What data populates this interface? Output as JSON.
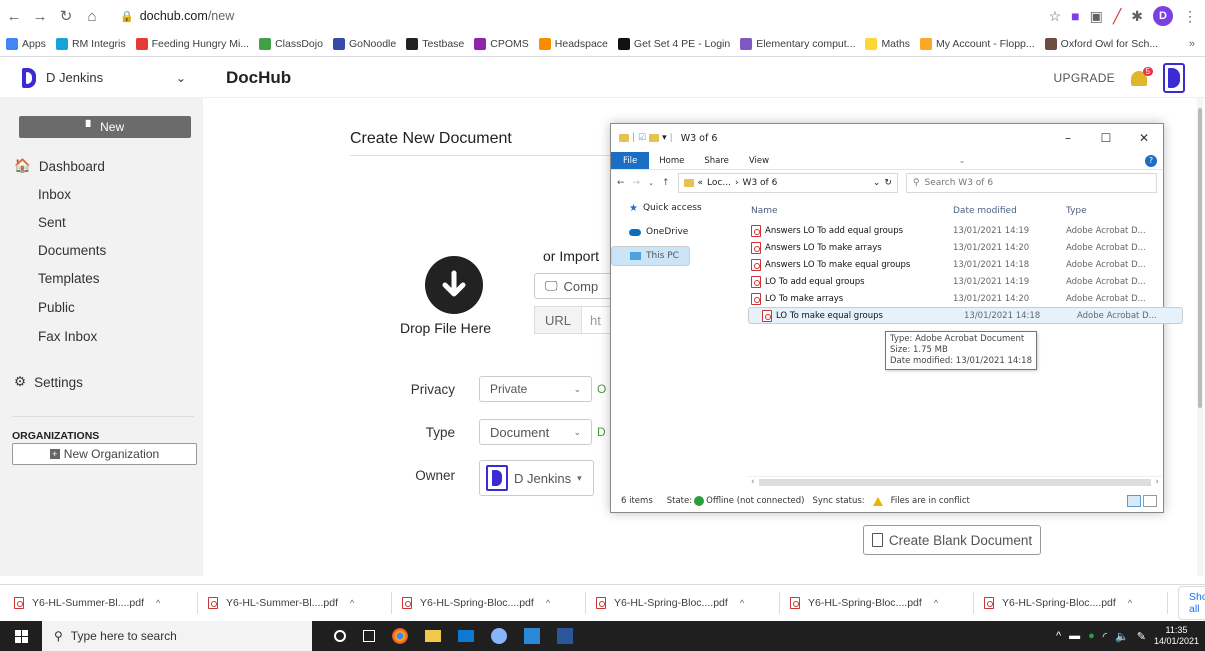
{
  "browser": {
    "url_host": "dochub.com",
    "url_path": "/new",
    "profile_initial": "D",
    "bookmarks": [
      {
        "label": "Apps",
        "color": "#4285f4"
      },
      {
        "label": "RM Integris",
        "color": "#1aa3d9"
      },
      {
        "label": "Feeding Hungry Mi...",
        "color": "#e53935"
      },
      {
        "label": "ClassDojo",
        "color": "#43a047"
      },
      {
        "label": "GoNoodle",
        "color": "#3949ab"
      },
      {
        "label": "Testbase",
        "color": "#222222"
      },
      {
        "label": "CPOMS",
        "color": "#8e24aa"
      },
      {
        "label": "Headspace",
        "color": "#fb8c00"
      },
      {
        "label": "Get Set 4 PE - Login",
        "color": "#111111"
      },
      {
        "label": "Elementary comput...",
        "color": "#7e57c2"
      },
      {
        "label": "Maths",
        "color": "#fdd835"
      },
      {
        "label": "My Account - Flopp...",
        "color": "#f9a825"
      },
      {
        "label": "Oxford Owl for Sch...",
        "color": "#6d4c41"
      }
    ],
    "bookmarks_more": "»"
  },
  "header": {
    "user_name": "D Jenkins",
    "brand": "DocHub",
    "upgrade": "UPGRADE",
    "notif_count": "5"
  },
  "sidebar": {
    "new_button": "New",
    "dashboard": "Dashboard",
    "items": [
      "Inbox",
      "Sent",
      "Documents",
      "Templates",
      "Public",
      "Fax Inbox"
    ],
    "settings": "Settings",
    "organizations_heading": "ORGANIZATIONS",
    "new_org_button": "New Organization"
  },
  "main": {
    "title": "Create New Document",
    "drop_label": "Drop File Here",
    "import_label": "or Import",
    "computer_label": "Comp",
    "url_label": "URL",
    "url_value": "ht",
    "privacy_label": "Privacy",
    "privacy_value": "Private",
    "privacy_note": "O",
    "type_label": "Type",
    "type_value": "Document",
    "type_note": "D",
    "owner_label": "Owner",
    "owner_value": "D Jenkins",
    "blank_button": "Create Blank Document"
  },
  "explorer": {
    "title": "W3 of 6",
    "ribbon": {
      "file": "File",
      "home": "Home",
      "share": "Share",
      "view": "View",
      "help": "?"
    },
    "path": [
      "Loc...",
      "W3 of 6"
    ],
    "search_placeholder": "Search W3 of 6",
    "nav": [
      {
        "label": "Quick access",
        "icon": "star-icon"
      },
      {
        "label": "OneDrive",
        "icon": "cloud-icon"
      },
      {
        "label": "This PC",
        "icon": "pc-icon"
      }
    ],
    "columns": {
      "name": "Name",
      "date": "Date modified",
      "type": "Type"
    },
    "files": [
      {
        "name": "Answers LO To add equal groups",
        "date": "13/01/2021 14:19",
        "type": "Adobe Acrobat D..."
      },
      {
        "name": "Answers LO To make arrays",
        "date": "13/01/2021 14:20",
        "type": "Adobe Acrobat D..."
      },
      {
        "name": "Answers LO To make equal groups",
        "date": "13/01/2021 14:18",
        "type": "Adobe Acrobat D..."
      },
      {
        "name": "LO To add equal groups",
        "date": "13/01/2021 14:19",
        "type": "Adobe Acrobat D..."
      },
      {
        "name": "LO To make arrays",
        "date": "13/01/2021 14:20",
        "type": "Adobe Acrobat D..."
      },
      {
        "name": "LO To make equal groups",
        "date": "13/01/2021 14:18",
        "type": "Adobe Acrobat D..."
      }
    ],
    "tooltip": {
      "type": "Type: Adobe Acrobat Document",
      "size": "Size: 1.75 MB",
      "modified": "Date modified: 13/01/2021 14:18"
    },
    "status": {
      "count": "6 items",
      "state_label": "State:",
      "state_value": "Offline (not connected)",
      "sync_label": "Sync status:",
      "sync_value": "Files are in conflict"
    }
  },
  "downloads": {
    "files": [
      "Y6-HL-Summer-Bl....pdf",
      "Y6-HL-Summer-Bl....pdf",
      "Y6-HL-Spring-Bloc....pdf",
      "Y6-HL-Spring-Bloc....pdf",
      "Y6-HL-Spring-Bloc....pdf",
      "Y6-HL-Spring-Bloc....pdf"
    ],
    "show_all": "Show all"
  },
  "taskbar": {
    "search_placeholder": "Type here to search",
    "time": "11:35",
    "date": "14/01/2021"
  }
}
